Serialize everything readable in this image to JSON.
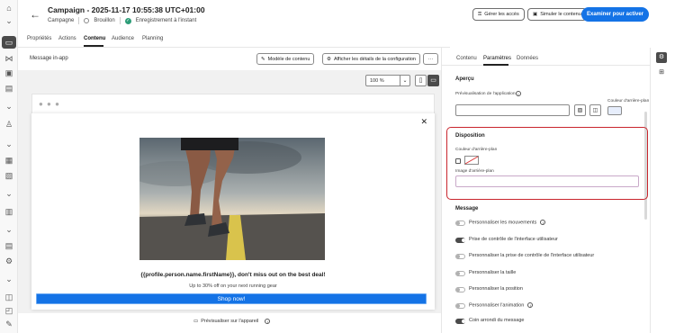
{
  "header": {
    "title": "Campaign - 2025-11-17 10:55:38 UTC+01:00",
    "breadcrumb": "Campagne",
    "status": "Brouillon",
    "saved_status": "Enregistrement à l'instant",
    "manage_access": "Gérer les accès",
    "simulate": "Simuler le contenu",
    "primary_action": "Examiner pour activer"
  },
  "nav_tabs": [
    "Propriétés",
    "Actions",
    "Contenu",
    "Audience",
    "Planning"
  ],
  "preview": {
    "label": "Message in-app",
    "content_template": "Modèle de contenu",
    "config_details": "Afficher les détails de la configuration",
    "more": "···",
    "zoom": "100 %",
    "headline": "{{profile.person.name.firstName}}, don't miss out on the best deal!",
    "subtext": "Up to 30% off on your next running gear",
    "button": "Shop now!",
    "device_preview": "Prévisualiser sur l'appareil"
  },
  "right_panel": {
    "tabs": [
      "Contenu",
      "Paramètres",
      "Données"
    ],
    "apercu_title": "Aperçu",
    "app_preview_label": "Prévisualisation de l'application",
    "bg_color_label_top": "Couleur d'arrière-plan",
    "disposition_title": "Disposition",
    "bg_color_label": "Couleur d'arrière-plan",
    "bg_image_label": "Image d'arrière-plan",
    "message_title": "Message",
    "toggles": [
      {
        "label": "Personnaliser les mouvements",
        "on": false,
        "info": true
      },
      {
        "label": "Prise de contrôle de l'interface utilisateur",
        "on": true,
        "info": false
      },
      {
        "label": "Personnaliser la prise de contrôle de l'interface utilisateur",
        "on": false,
        "info": false
      },
      {
        "label": "Personnaliser la taille",
        "on": false,
        "info": false
      },
      {
        "label": "Personnaliser la position",
        "on": false,
        "info": false
      },
      {
        "label": "Personnaliser l'animation",
        "on": false,
        "info": true
      },
      {
        "label": "Coin arrondi du message",
        "on": true,
        "info": false
      }
    ]
  },
  "colors": {
    "accent": "#1473e6",
    "highlight_border": "#c9252d",
    "swatch": "#e7eefc"
  }
}
